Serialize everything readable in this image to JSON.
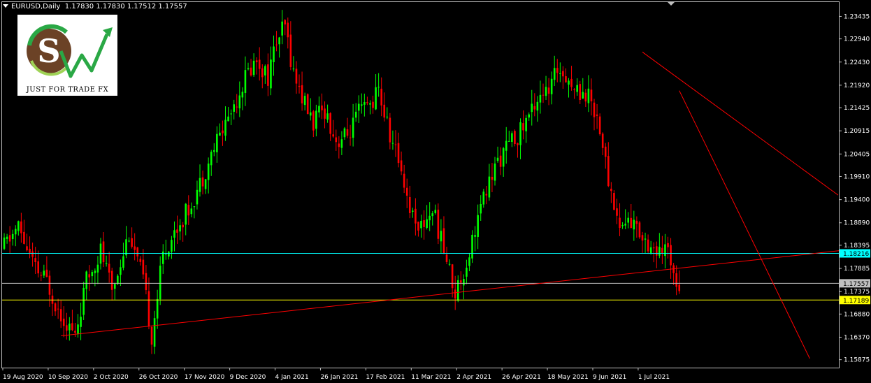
{
  "header": {
    "symbol": "EURUSD,Daily",
    "ohlc": "1.17830 1.17830 1.17512 1.17557"
  },
  "logo": {
    "text": "JUST FOR TRADE FX"
  },
  "colors": {
    "background": "#000000",
    "bull": "#00ff00",
    "bear": "#ff0000",
    "trendline": "#ff0000",
    "level_resistance": "#00ffff",
    "level_support": "#ffff00",
    "current_price_line": "#c0c0c0",
    "frame": "#c0c0c0"
  },
  "chart_data": {
    "type": "candlestick",
    "symbol": "EURUSD",
    "timeframe": "Daily",
    "ylim": [
      1.157,
      1.2375
    ],
    "y_ticks": [
      "1.23435",
      "1.22940",
      "1.22430",
      "1.21920",
      "1.21425",
      "1.20915",
      "1.20405",
      "1.19910",
      "1.19400",
      "1.18890",
      "1.18395",
      "1.17885",
      "1.17375",
      "1.16880",
      "1.16370",
      "1.15875"
    ],
    "x_labels": [
      "19 Aug 2020",
      "10 Sep 2020",
      "2 Oct 2020",
      "26 Oct 2020",
      "17 Nov 2020",
      "9 Dec 2020",
      "4 Jan 2021",
      "26 Jan 2021",
      "17 Feb 2021",
      "11 Mar 2021",
      "2 Apr 2021",
      "26 Apr 2021",
      "18 May 2021",
      "9 Jun 2021",
      "1 Jul 2021"
    ],
    "x_label_bars": [
      0,
      16,
      32,
      48,
      64,
      80,
      96,
      112,
      128,
      144,
      160,
      176,
      192,
      208,
      224
    ],
    "total_bars": 239,
    "bars_on_axis": 295,
    "price_path": [
      [
        0,
        1.183
      ],
      [
        6,
        1.188
      ],
      [
        12,
        1.1785
      ],
      [
        16,
        1.176
      ],
      [
        20,
        1.17
      ],
      [
        26,
        1.164
      ],
      [
        30,
        1.176
      ],
      [
        35,
        1.183
      ],
      [
        39,
        1.174
      ],
      [
        45,
        1.187
      ],
      [
        50,
        1.176
      ],
      [
        53,
        1.164
      ],
      [
        57,
        1.182
      ],
      [
        62,
        1.188
      ],
      [
        66,
        1.192
      ],
      [
        70,
        1.1975
      ],
      [
        76,
        1.207
      ],
      [
        82,
        1.215
      ],
      [
        86,
        1.221
      ],
      [
        90,
        1.225
      ],
      [
        94,
        1.221
      ],
      [
        97,
        1.229
      ],
      [
        100,
        1.232
      ],
      [
        103,
        1.222
      ],
      [
        107,
        1.215
      ],
      [
        110,
        1.211
      ],
      [
        114,
        1.214
      ],
      [
        118,
        1.207
      ],
      [
        122,
        1.208
      ],
      [
        126,
        1.213
      ],
      [
        130,
        1.215
      ],
      [
        133,
        1.218
      ],
      [
        137,
        1.208
      ],
      [
        141,
        1.201
      ],
      [
        144,
        1.192
      ],
      [
        148,
        1.188
      ],
      [
        152,
        1.192
      ],
      [
        156,
        1.183
      ],
      [
        160,
        1.1735
      ],
      [
        164,
        1.18
      ],
      [
        167,
        1.188
      ],
      [
        171,
        1.196
      ],
      [
        175,
        1.2025
      ],
      [
        179,
        1.206
      ],
      [
        183,
        1.209
      ],
      [
        187,
        1.214
      ],
      [
        190,
        1.218
      ],
      [
        193,
        1.217
      ],
      [
        196,
        1.223
      ],
      [
        199,
        1.222
      ],
      [
        202,
        1.218
      ],
      [
        205,
        1.218
      ],
      [
        208,
        1.216
      ],
      [
        211,
        1.21
      ],
      [
        214,
        1.198
      ],
      [
        218,
        1.188
      ],
      [
        221,
        1.1895
      ],
      [
        225,
        1.187
      ],
      [
        229,
        1.184
      ],
      [
        232,
        1.1815
      ],
      [
        235,
        1.183
      ],
      [
        238,
        1.177
      ],
      [
        239,
        1.1756
      ]
    ],
    "levels": [
      {
        "price": 1.18216,
        "label": "1.18216",
        "color": "#00ffff"
      },
      {
        "price": 1.17557,
        "label": "1.17557",
        "color": "#c0c0c0"
      },
      {
        "price": 1.17189,
        "label": "1.17189",
        "color": "#ffff00"
      }
    ],
    "trendlines": [
      {
        "from": [
          20,
          1.164
        ],
        "to": [
          295,
          1.1828
        ]
      },
      {
        "from": [
          225,
          1.2265
        ],
        "to": [
          294,
          1.195
        ]
      },
      {
        "from": [
          238,
          1.218
        ],
        "to": [
          284,
          1.159
        ]
      }
    ],
    "grid": false,
    "legend": "none"
  }
}
